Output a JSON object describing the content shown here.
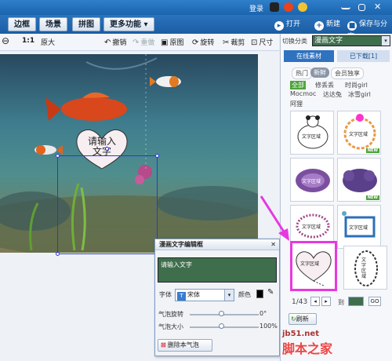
{
  "topbar": {
    "login": "登录"
  },
  "menubar": {
    "tabs": [
      "边框",
      "场景",
      "拼图",
      "更多功能 ▾"
    ],
    "open": "打开",
    "new": "新建",
    "save": "保存与分享"
  },
  "toolbar": {
    "zoom_ratio": "1:1",
    "original_size": "原大",
    "undo": "撤销",
    "redo": "重做",
    "original": "原图",
    "rotate": "旋转",
    "crop": "裁剪",
    "size": "尺寸"
  },
  "canvas": {
    "bubble_text": "请输入文字"
  },
  "dialog": {
    "title": "漫画文字编辑框",
    "close": "✕",
    "text_value": "请输入文字",
    "font_label": "字体",
    "font_value": "宋体",
    "color_label": "颜色",
    "rotate_label": "气泡旋转",
    "rotate_value": "0°",
    "size_label": "气泡大小",
    "size_value": "100%",
    "delete_button": "删除本气泡"
  },
  "panel": {
    "category_label": "切换分类",
    "category_value": "漫画文字",
    "tab_online": "在线素材",
    "tab_downloaded": "已下载[1]",
    "filters": [
      "热门",
      "新鲜",
      "会员独享"
    ],
    "tags": [
      "全部",
      "修丢丢",
      "时尚girl",
      "Mocmoc",
      "达达兔",
      "冰雪girl",
      "阿狸"
    ],
    "tile_label": "文字区域",
    "new_badge": "NEW",
    "pager": "1/43",
    "goto": "到",
    "go": "GO",
    "refresh": "刷新"
  },
  "watermark": {
    "site": "jb51.net",
    "brand": "脚本之家"
  },
  "colors": {
    "accent_blue": "#1e66b3",
    "selection": "#2e36d8",
    "highlight": "#e838e0",
    "text_bg": "#3f6e4c",
    "tag_all_bg": "#4da33a"
  }
}
